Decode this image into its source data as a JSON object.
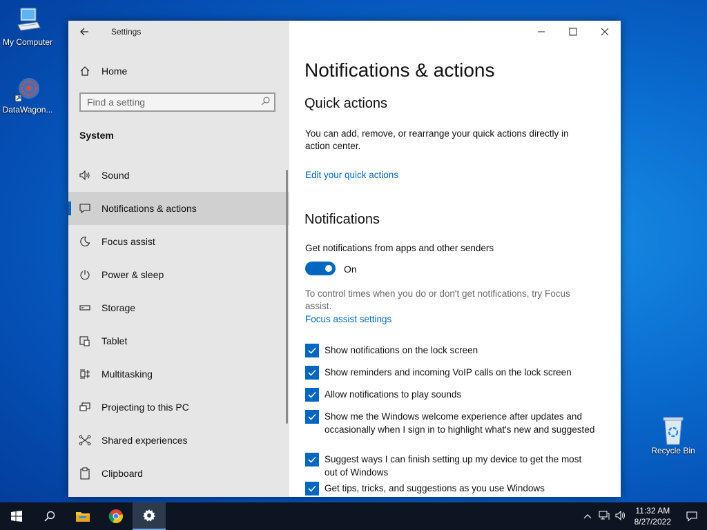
{
  "desktop": {
    "icons": [
      {
        "label": "My Computer"
      },
      {
        "label": "DataWagon..."
      },
      {
        "label": "Recycle Bin"
      }
    ]
  },
  "window": {
    "app_title": "Settings",
    "home_label": "Home",
    "search_placeholder": "Find a setting",
    "section": "System",
    "nav": [
      {
        "label": "Sound",
        "icon": "speaker-icon"
      },
      {
        "label": "Notifications & actions",
        "icon": "message-icon",
        "active": true
      },
      {
        "label": "Focus assist",
        "icon": "moon-icon"
      },
      {
        "label": "Power & sleep",
        "icon": "power-icon"
      },
      {
        "label": "Storage",
        "icon": "storage-icon"
      },
      {
        "label": "Tablet",
        "icon": "tablet-icon"
      },
      {
        "label": "Multitasking",
        "icon": "multitasking-icon"
      },
      {
        "label": "Projecting to this PC",
        "icon": "projector-icon"
      },
      {
        "label": "Shared experiences",
        "icon": "shared-icon"
      },
      {
        "label": "Clipboard",
        "icon": "clipboard-icon"
      }
    ]
  },
  "content": {
    "title": "Notifications & actions",
    "quick_actions": {
      "heading": "Quick actions",
      "description": "You can add, remove, or rearrange your quick actions directly in action center.",
      "link": "Edit your quick actions"
    },
    "notifications": {
      "heading": "Notifications",
      "toggle_label": "Get notifications from apps and other senders",
      "toggle_state": "On",
      "focus_hint": "To control times when you do or don't get notifications, try Focus assist.",
      "focus_link": "Focus assist settings",
      "checkboxes": [
        {
          "label": "Show notifications on the lock screen",
          "checked": true
        },
        {
          "label": "Show reminders and incoming VoIP calls on the lock screen",
          "checked": true
        },
        {
          "label": "Allow notifications to play sounds",
          "checked": true
        },
        {
          "label": "Show me the Windows welcome experience after updates and occasionally when I sign in to highlight what's new and suggested",
          "checked": true
        },
        {
          "label": "Suggest ways I can finish setting up my device to get the most out of Windows",
          "checked": true
        },
        {
          "label": "Get tips, tricks, and suggestions as you use Windows",
          "checked": true
        }
      ]
    }
  },
  "taskbar": {
    "time": "11:32 AM",
    "date": "8/27/2022"
  },
  "colors": {
    "accent": "#0067c0",
    "link": "#0067b8",
    "sidebar_bg": "#e6e6e6",
    "taskbar_bg": "#0d1522"
  }
}
